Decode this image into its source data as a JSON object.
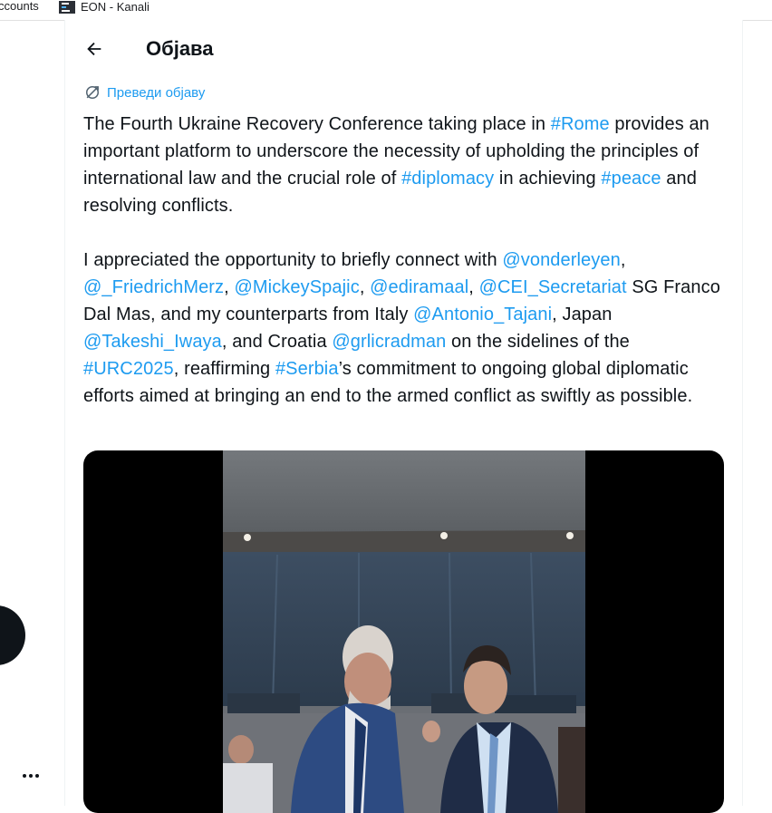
{
  "bookmarks": {
    "accounts": "ccounts",
    "eon": "EON - Kanali"
  },
  "header": {
    "title": "Објава"
  },
  "post": {
    "translate_label": "Преведи објаву",
    "paragraph1": [
      {
        "t": "The Fourth Ukraine Recovery Conference taking place in "
      },
      {
        "t": "#Rome",
        "link": true
      },
      {
        "t": " provides an important platform to underscore the necessity of upholding the principles of international law and the crucial role of "
      },
      {
        "t": "#diplomacy",
        "link": true
      },
      {
        "t": " in achieving "
      },
      {
        "t": "#peace",
        "link": true
      },
      {
        "t": " and resolving conflicts."
      }
    ],
    "paragraph2": [
      {
        "t": "I appreciated the opportunity to briefly connect with "
      },
      {
        "t": "@vonderleyen",
        "link": true
      },
      {
        "t": ", "
      },
      {
        "t": "@_FriedrichMerz",
        "link": true
      },
      {
        "t": ", "
      },
      {
        "t": "@MickeySpajic",
        "link": true
      },
      {
        "t": ", "
      },
      {
        "t": "@ediramaal",
        "link": true
      },
      {
        "t": ", "
      },
      {
        "t": "@CEI_Secretariat",
        "link": true
      },
      {
        "t": " SG Franco Dal Mas, and my counterparts from Italy "
      },
      {
        "t": "@Antonio_Tajani",
        "link": true
      },
      {
        "t": ", Japan "
      },
      {
        "t": "@Takeshi_Iwaya",
        "link": true
      },
      {
        "t": ", and Croatia "
      },
      {
        "t": "@grlicradman",
        "link": true
      },
      {
        "t": " on the sidelines of the "
      },
      {
        "t": "#URC2025",
        "link": true
      },
      {
        "t": ", reaffirming "
      },
      {
        "t": "#Serbia",
        "link": true
      },
      {
        "t": "’s commitment to ongoing global diplomatic efforts aimed at bringing an end to the armed conflict as swiftly as possible."
      }
    ]
  },
  "icons": {
    "back": "arrow-left-icon",
    "translate": "translate-icon",
    "more": "more-dots-icon"
  },
  "colors": {
    "link": "#1d9bf0",
    "text": "#0f1419",
    "media_bg": "#000000"
  }
}
